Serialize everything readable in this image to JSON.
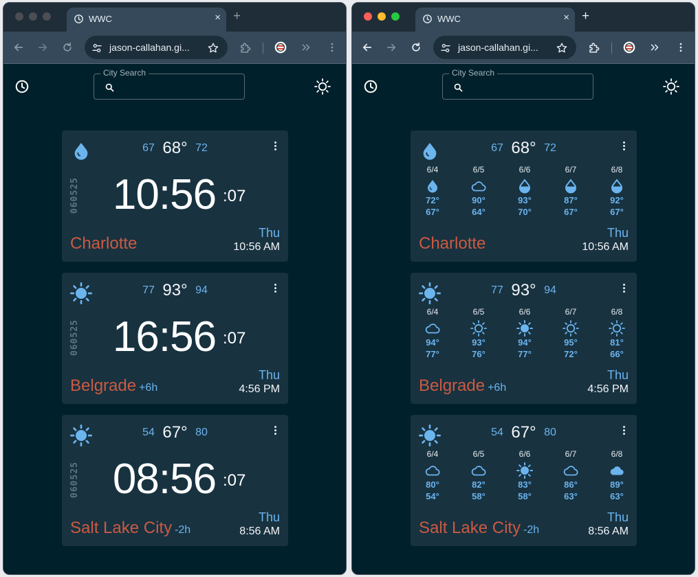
{
  "tab_title": "WWC",
  "tab_close": "×",
  "new_tab": "+",
  "url": "jason-callahan.gi...",
  "search_label": "City Search",
  "date_code": "060525",
  "colors": {
    "accent": "#6cb4ee",
    "city": "#cc5a42",
    "card": "#183240",
    "page": "#00202b"
  },
  "cities": [
    {
      "name": "Charlotte",
      "offset": "",
      "icon": "drop-icon",
      "low": "67",
      "current": "68°",
      "high": "72",
      "hm": "10:56",
      "sec": ":07",
      "day": "Thu",
      "local_time": "10:56 AM",
      "forecast": [
        {
          "date": "6/4",
          "icon": "drop-icon",
          "hi": "72°",
          "lo": "67°"
        },
        {
          "date": "6/5",
          "icon": "cloud-icon",
          "hi": "90°",
          "lo": "64°"
        },
        {
          "date": "6/6",
          "icon": "drop-half-icon",
          "hi": "93°",
          "lo": "70°"
        },
        {
          "date": "6/7",
          "icon": "drop-half-icon",
          "hi": "87°",
          "lo": "67°"
        },
        {
          "date": "6/8",
          "icon": "drop-half-icon",
          "hi": "92°",
          "lo": "67°"
        }
      ]
    },
    {
      "name": "Belgrade",
      "offset": "+6h",
      "icon": "sun-icon",
      "low": "77",
      "current": "93°",
      "high": "94",
      "hm": "16:56",
      "sec": ":07",
      "day": "Thu",
      "local_time": "4:56 PM",
      "forecast": [
        {
          "date": "6/4",
          "icon": "cloud-icon",
          "hi": "94°",
          "lo": "77°"
        },
        {
          "date": "6/5",
          "icon": "sun-outline-icon",
          "hi": "93°",
          "lo": "76°"
        },
        {
          "date": "6/6",
          "icon": "sun-icon",
          "hi": "94°",
          "lo": "77°"
        },
        {
          "date": "6/7",
          "icon": "sun-outline-icon",
          "hi": "95°",
          "lo": "72°"
        },
        {
          "date": "6/8",
          "icon": "sun-outline-icon",
          "hi": "81°",
          "lo": "66°"
        }
      ]
    },
    {
      "name": "Salt Lake City",
      "offset": "-2h",
      "icon": "sun-icon",
      "low": "54",
      "current": "67°",
      "high": "80",
      "hm": "08:56",
      "sec": ":07",
      "day": "Thu",
      "local_time": "8:56 AM",
      "forecast": [
        {
          "date": "6/4",
          "icon": "cloud-icon",
          "hi": "80°",
          "lo": "54°"
        },
        {
          "date": "6/5",
          "icon": "cloud-icon",
          "hi": "82°",
          "lo": "58°"
        },
        {
          "date": "6/6",
          "icon": "sun-icon",
          "hi": "83°",
          "lo": "58°"
        },
        {
          "date": "6/7",
          "icon": "cloud-icon",
          "hi": "86°",
          "lo": "63°"
        },
        {
          "date": "6/8",
          "icon": "cloud-filled-icon",
          "hi": "89°",
          "lo": "63°"
        }
      ]
    }
  ]
}
